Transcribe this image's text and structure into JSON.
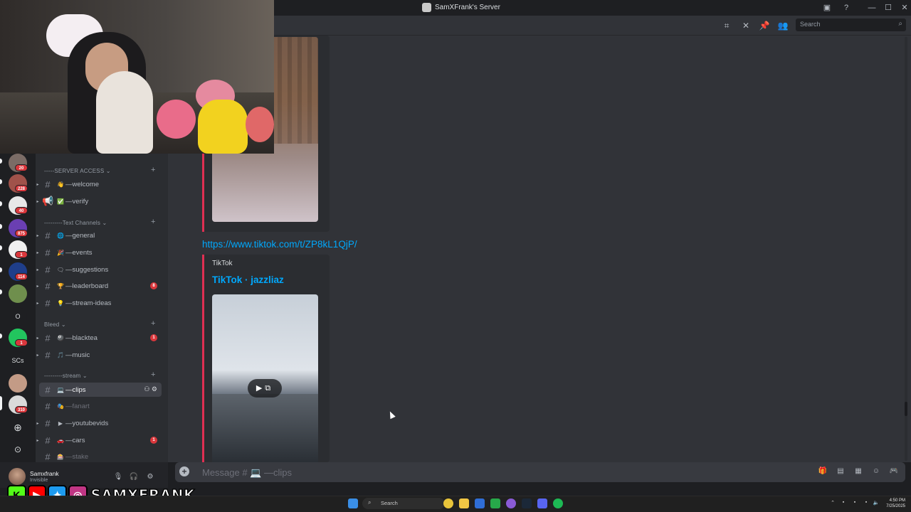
{
  "window": {
    "title": "SamXFrank's Server"
  },
  "header": {
    "search_placeholder": "Search"
  },
  "server_rail": {
    "badges": [
      "20",
      "228",
      "40",
      "875",
      "1",
      "114",
      "1",
      "310"
    ],
    "text_servers": [
      "O",
      "SCs"
    ]
  },
  "categories": {
    "server_access": "-----SERVER ACCESS",
    "text_channels": "---------Text Channels",
    "bleed": "Bleed",
    "stream": "---------stream"
  },
  "channels": {
    "welcome": {
      "name": "—welcome",
      "emoji": "👋"
    },
    "verify": {
      "name": "—verify",
      "emoji": "✅"
    },
    "general": {
      "name": "—general",
      "emoji": "🌐"
    },
    "events": {
      "name": "—events",
      "emoji": "🎉"
    },
    "suggestions": {
      "name": "—suggestions",
      "emoji": "🗨"
    },
    "leaderboard": {
      "name": "—leaderboard",
      "emoji": "🏆",
      "mention": "8"
    },
    "stream_ideas": {
      "name": "—stream-ideas",
      "emoji": "💡"
    },
    "blacktea": {
      "name": "—blacktea",
      "emoji": "🎱",
      "mention": "1"
    },
    "music": {
      "name": "—music",
      "emoji": "🎵"
    },
    "clips": {
      "name": "—clips",
      "emoji": "💻"
    },
    "fanart": {
      "name": "—fanart",
      "emoji": "🎭"
    },
    "youtubevids": {
      "name": "—youtubevids",
      "emoji": "▶"
    },
    "cars": {
      "name": "—cars",
      "emoji": "🚗",
      "mention": "1"
    },
    "stake": {
      "name": "—stake",
      "emoji": "🎰"
    }
  },
  "user": {
    "name": "Samxfrank",
    "status": "Invisible"
  },
  "social": {
    "handle": "SAMXFRANK",
    "icons": [
      "kick-icon",
      "youtube-icon",
      "twitter-icon",
      "instagram-icon"
    ],
    "kick_letter": "K"
  },
  "chat": {
    "link": "https://www.tiktok.com/t/ZP8kL1QjP/",
    "embed_provider": "TikTok",
    "embed_title": "TikTok · jazzliaz"
  },
  "composer": {
    "placeholder": "Message # 💻 —clips"
  },
  "taskbar": {
    "search_label": "Search",
    "time": "4:50 PM",
    "date": "7/25/2025"
  },
  "colors": {
    "accent_link": "#00a8fc",
    "embed_bar": "#e02f52",
    "badge": "#da373c"
  }
}
